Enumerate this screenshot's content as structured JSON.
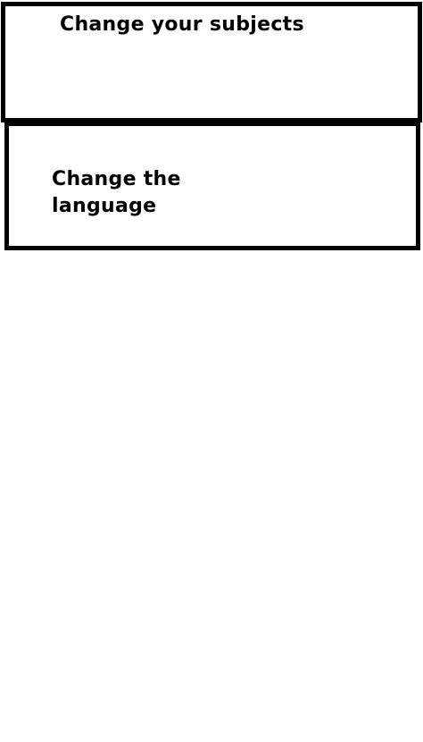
{
  "options": [
    {
      "id": "subjects",
      "label": "Change your subjects"
    },
    {
      "id": "language",
      "label": "Change the language"
    }
  ],
  "colors": {
    "background": "#ffffff",
    "border": "#000000",
    "text": "#000000"
  }
}
